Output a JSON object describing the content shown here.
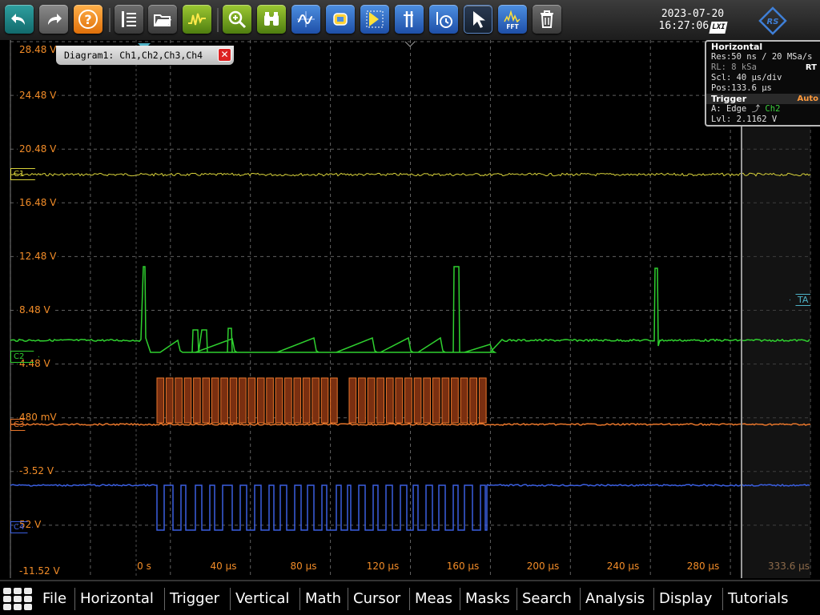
{
  "toolbar": {
    "buttons": [
      {
        "icon": "undo-icon"
      },
      {
        "icon": "redo-icon"
      },
      {
        "icon": "help-icon",
        "glyph": "?"
      },
      {
        "icon": "toolbar-config-icon"
      },
      {
        "icon": "open-folder-icon"
      },
      {
        "icon": "autoset-icon"
      },
      {
        "icon": "zoom-icon"
      },
      {
        "icon": "search-binoculars-icon"
      },
      {
        "icon": "measurement-icon"
      },
      {
        "icon": "reference-icon"
      },
      {
        "icon": "mask-icon"
      },
      {
        "icon": "cursor-icon"
      },
      {
        "icon": "timer-icon"
      },
      {
        "icon": "pointer-icon"
      },
      {
        "icon": "fft-icon",
        "label": "FFT"
      },
      {
        "icon": "delete-icon"
      }
    ],
    "date": "2023-07-20",
    "time": "16:27:06",
    "lxi": "LXI"
  },
  "diagram": {
    "tab_label": "Diagram1: Ch1,Ch2,Ch3,Ch4",
    "close_label": "✕",
    "y_labels": [
      "28.48 V",
      "24.48 V",
      "20.48 V",
      "16.48 V",
      "12.48 V",
      "8.48 V",
      "4.48 V",
      "480 mV",
      "-3.52 V",
      "52 V",
      "-11.52 V"
    ],
    "x_labels": [
      "0 s",
      "40 µs",
      "80 µs",
      "120 µs",
      "160 µs",
      "200 µs",
      "240 µs",
      "280 µs",
      "333.6 µs"
    ],
    "channel_markers": {
      "c1": "C1",
      "c2": "C2",
      "c3": "C3",
      "c4": "C4",
      "trigger_marker": "TA"
    },
    "colors": {
      "ch1": "#d8d23a",
      "ch2": "#2fd02f",
      "ch3": "#e8762b",
      "ch4": "#3b5fe0",
      "axis_text": "#f28c28"
    }
  },
  "horizontal_panel": {
    "title": "Horizontal",
    "res": "Res:50 ns / 20 MSa/s",
    "rl": "RL:  8 kSa",
    "rt": "RT",
    "scl": "Scl: 40 µs/div",
    "pos": "Pos:133.6 µs"
  },
  "trigger_panel": {
    "title": "Trigger",
    "mode": "Auto",
    "source_prefix": "A:   Edge",
    "source_channel": "Ch2",
    "level": "Lvl: 2.1162 V"
  },
  "menu": [
    "File",
    "Horizontal",
    "Trigger",
    "Vertical",
    "Math",
    "Cursor",
    "Meas",
    "Masks",
    "Search",
    "Analysis",
    "Display",
    "Tutorials"
  ]
}
